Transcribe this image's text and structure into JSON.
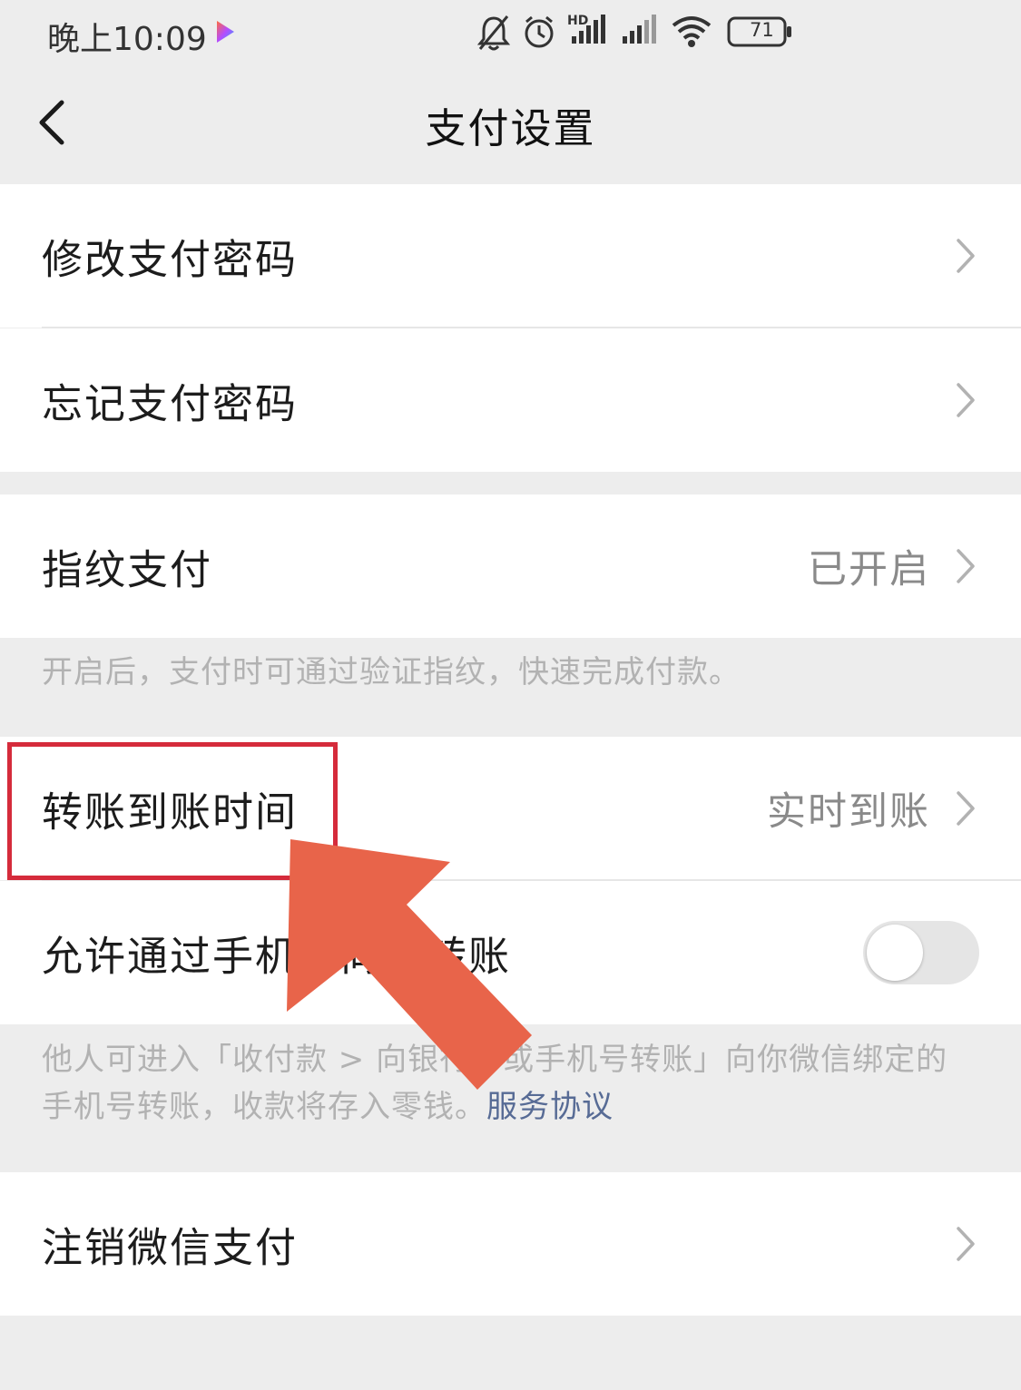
{
  "status_bar": {
    "time": "晚上10:09",
    "battery_level": "71",
    "hd_badge": "HD",
    "icons": [
      "play-badge-icon",
      "mute-bell-icon",
      "alarm-icon",
      "signal-icon",
      "signal-icon",
      "wifi-icon",
      "battery-icon"
    ]
  },
  "navbar": {
    "title": "支付设置",
    "back_icon": "chevron-left-icon"
  },
  "groups": {
    "password": {
      "change_label": "修改支付密码",
      "forgot_label": "忘记支付密码"
    },
    "fingerprint": {
      "label": "指纹支付",
      "value": "已开启",
      "description": "开启后，支付时可通过验证指纹，快速完成付款。"
    },
    "transfer": {
      "arrival_time_label": "转账到账时间",
      "arrival_time_value": "实时到账",
      "phone_transfer_label": "允许通过手机号向我转账",
      "phone_transfer_enabled": false,
      "phone_transfer_description": "他人可进入「收付款 > 向银行卡或手机号转账」向你微信绑定的手机号转账，收款将存入零钱。",
      "service_link": "服务协议"
    },
    "deactivate": {
      "label": "注销微信支付"
    }
  },
  "annotation": {
    "highlight_color": "#d52b3b",
    "arrow_color": "#e8644a"
  },
  "colors": {
    "background": "#ededed",
    "link": "#576b95",
    "secondary_text": "#8a8a8a"
  }
}
